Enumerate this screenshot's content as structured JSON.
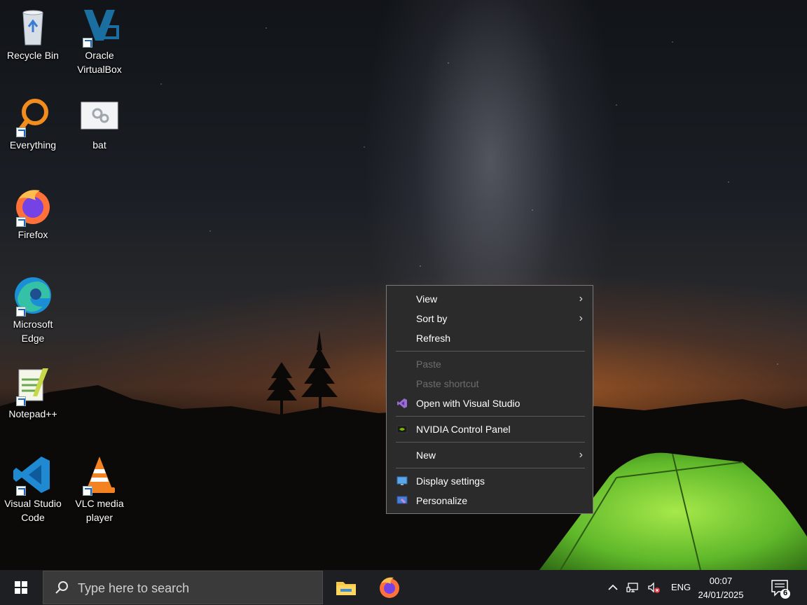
{
  "desktop": {
    "icons": [
      {
        "label_lines": [
          "Recycle Bin"
        ],
        "icon": "recycle-bin-icon"
      },
      {
        "label_lines": [
          "Oracle",
          "VirtualBox"
        ],
        "icon": "virtualbox-icon"
      },
      {
        "label_lines": [
          "Everything"
        ],
        "icon": "everything-search-icon"
      },
      {
        "label_lines": [
          "bat"
        ],
        "icon": "bat-file-icon"
      },
      {
        "label_lines": [
          "Firefox"
        ],
        "icon": "firefox-icon"
      },
      {
        "label_lines": [
          "Microsoft",
          "Edge"
        ],
        "icon": "edge-icon"
      },
      {
        "label_lines": [
          "Notepad++"
        ],
        "icon": "notepadpp-icon"
      },
      {
        "label_lines": [
          "Visual Studio",
          "Code"
        ],
        "icon": "vscode-icon"
      },
      {
        "label_lines": [
          "VLC media",
          "player"
        ],
        "icon": "vlc-icon"
      }
    ]
  },
  "context_menu": {
    "items": [
      {
        "label": "View",
        "submenu": true
      },
      {
        "label": "Sort by",
        "submenu": true
      },
      {
        "label": "Refresh"
      },
      {
        "label": "Paste",
        "disabled": true
      },
      {
        "label": "Paste shortcut",
        "disabled": true
      },
      {
        "label": "Open with Visual Studio",
        "icon": "visual-studio-icon"
      },
      {
        "label": "NVIDIA Control Panel",
        "icon": "nvidia-icon"
      },
      {
        "label": "New",
        "submenu": true
      },
      {
        "label": "Display settings",
        "icon": "display-settings-icon"
      },
      {
        "label": "Personalize",
        "icon": "personalize-icon"
      }
    ],
    "submenu_glyph": "›"
  },
  "taskbar": {
    "search_placeholder": "Type here to search",
    "pinned": [
      "file-explorer-icon",
      "firefox-icon"
    ],
    "tray": {
      "language": "ENG",
      "time": "00:07",
      "date": "24/01/2025",
      "notification_count": "6"
    }
  },
  "colors": {
    "menu_bg": "#2b2b2b",
    "taskbar_bg": "#1e1f22",
    "accent_blue": "#0078d4"
  }
}
